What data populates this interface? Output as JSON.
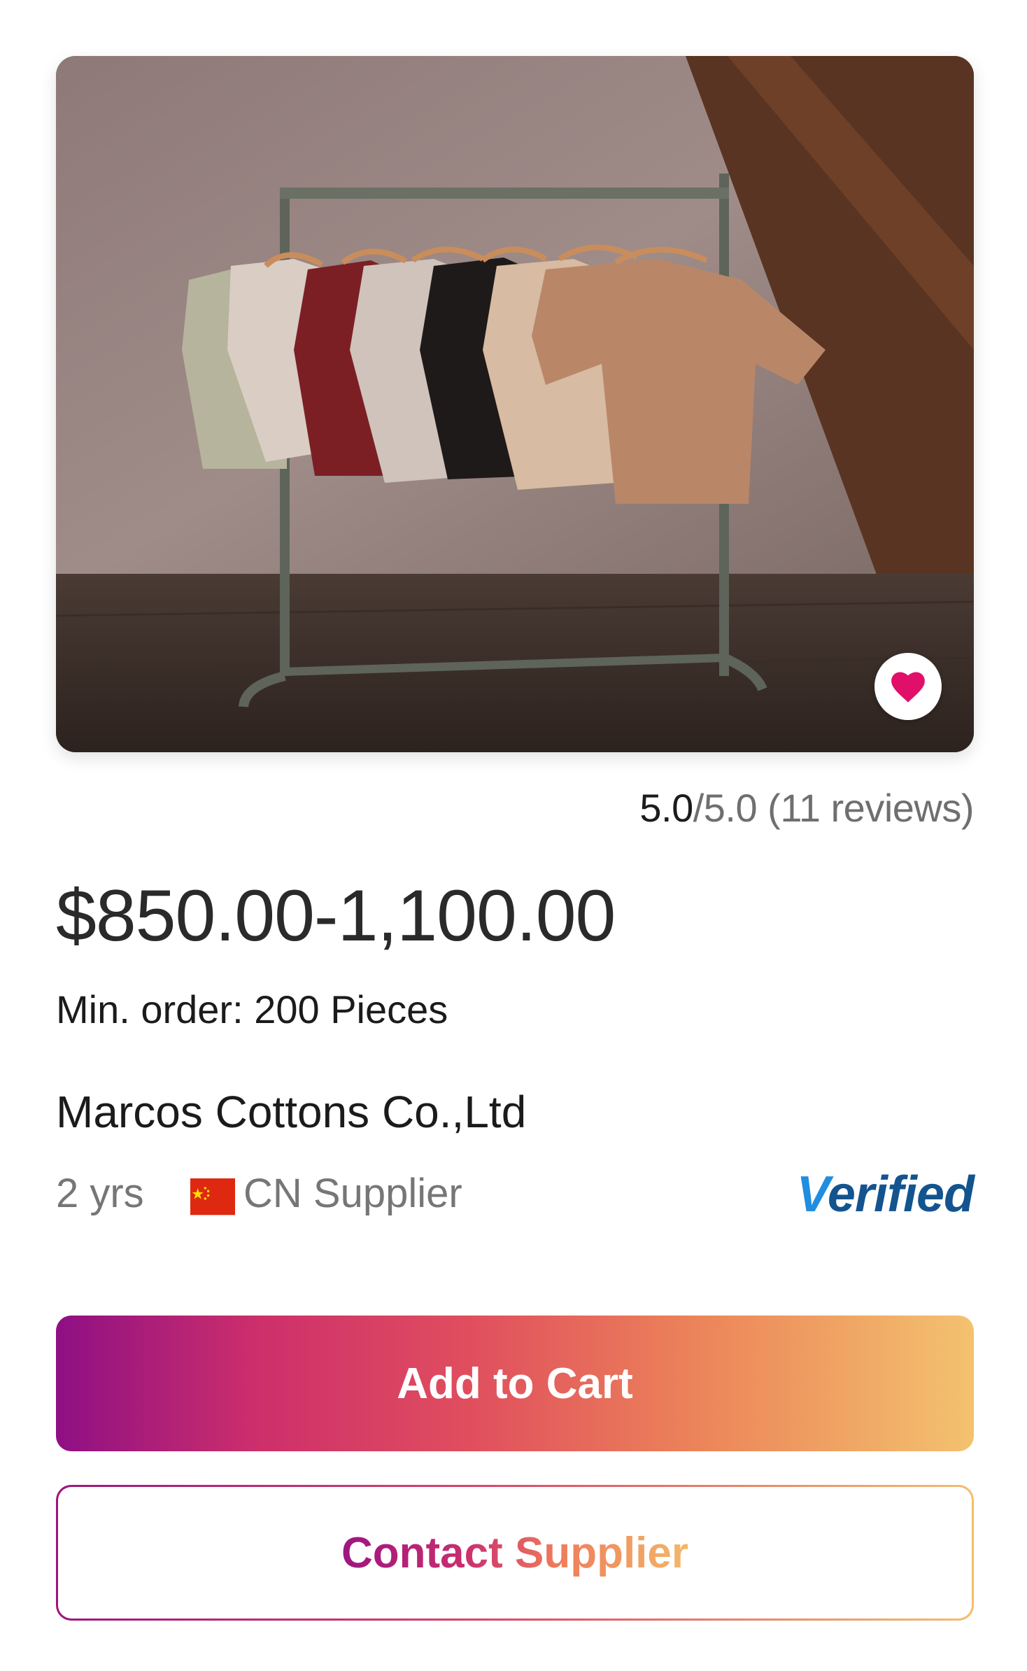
{
  "product": {
    "image_alt": "Clothing rack with t-shirts",
    "favorite_icon": "heart-icon"
  },
  "rating": {
    "score": "5.0",
    "rest": "/5.0 (11 reviews)"
  },
  "price": "$850.00-1,100.00",
  "min_order": "Min. order: 200 Pieces",
  "supplier": {
    "name": "Marcos Cottons Co.,Ltd",
    "years": "2 yrs",
    "country": "CN Supplier",
    "flag_icon": "china-flag-icon",
    "verified_first": "V",
    "verified_rest": "erified"
  },
  "actions": {
    "add_to_cart": "Add to Cart",
    "contact_supplier": "Contact Supplier"
  },
  "colors": {
    "heart": "#e0106a",
    "verified": "#13548f",
    "gradient_start": "#8e0f84",
    "gradient_end": "#f3c26f"
  }
}
